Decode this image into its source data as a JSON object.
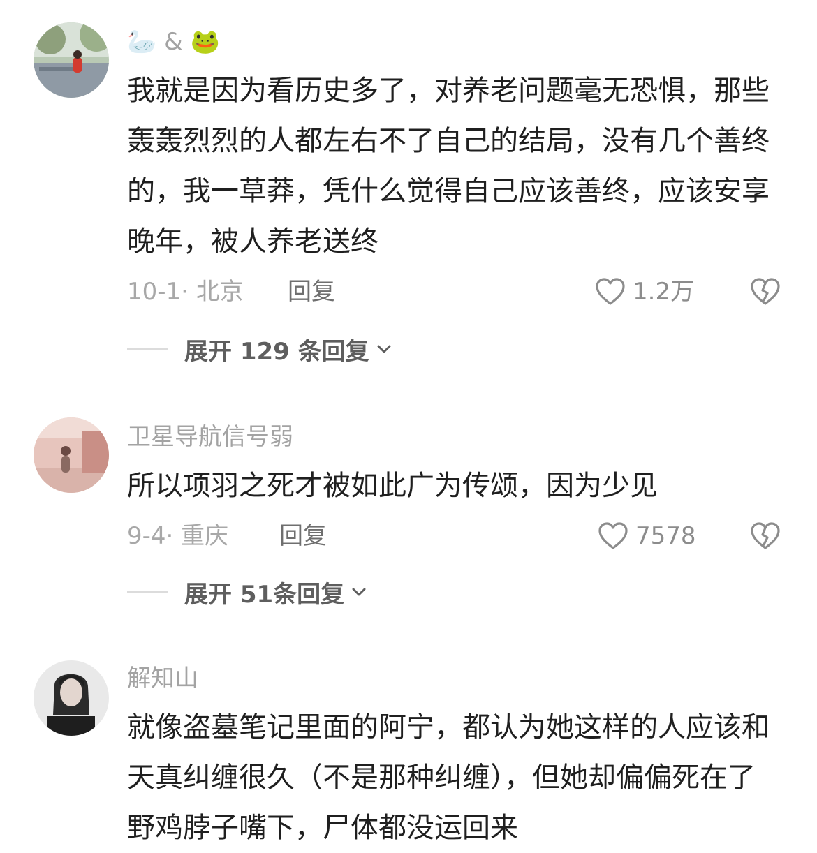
{
  "comments": [
    {
      "username_prefix": "🦢",
      "username_mid": "&",
      "username_suffix": "🐸",
      "text": "我就是因为看历史多了，对养老问题毫无恐惧，那些轰轰烈烈的人都左右不了自己的结局，没有几个善终的，我一草莽，凭什么觉得自己应该善终，应该安享晚年，被人养老送终",
      "date_location": "10-1· 北京",
      "reply_label": "回复",
      "likes": "1.2万",
      "expand_label": "展开 129 条回复",
      "avatar_icon": "avatar-photo-girl-red-dress"
    },
    {
      "username": "卫星导航信号弱",
      "text": "所以项羽之死才被如此广为传颂，因为少见",
      "date_location": "9-4· 重庆",
      "reply_label": "回复",
      "likes": "7578",
      "expand_label": "展开 51条回复",
      "avatar_icon": "avatar-photo-pink-wall"
    },
    {
      "username": "解知山",
      "text": "就像盗墓笔记里面的阿宁，都认为她这样的人应该和天真纠缠很久（不是那种纠缠），但她却偏偏死在了野鸡脖子嘴下，尸体都没运回来",
      "avatar_icon": "avatar-photo-woman-portrait"
    }
  ],
  "icons": {
    "like": "heart-outline-icon",
    "dislike": "broken-heart-icon",
    "expand": "chevron-down-icon"
  },
  "colors": {
    "text": "#1f1f1f",
    "muted": "#a8a8a8",
    "reply": "#6f6f6f",
    "expand": "#5e5e5e"
  }
}
